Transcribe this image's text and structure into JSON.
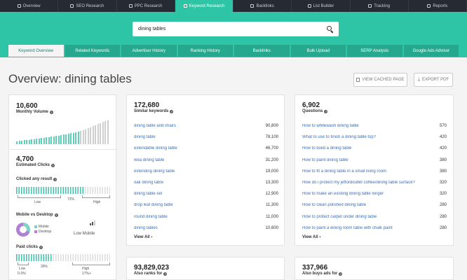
{
  "nav": {
    "items": [
      {
        "label": "Overview",
        "active": false
      },
      {
        "label": "SEO Research",
        "active": false
      },
      {
        "label": "PPC Research",
        "active": false
      },
      {
        "label": "Keyword Research",
        "active": true
      },
      {
        "label": "Backlinks",
        "active": false
      },
      {
        "label": "List Builder",
        "active": false
      },
      {
        "label": "Tracking",
        "active": false
      },
      {
        "label": "Reports",
        "active": false
      }
    ]
  },
  "search": {
    "value": "dining tables"
  },
  "subtabs": [
    {
      "label": "Keyword Overview",
      "active": true
    },
    {
      "label": "Related Keywords",
      "active": false
    },
    {
      "label": "Advertiser History",
      "active": false
    },
    {
      "label": "Ranking History",
      "active": false
    },
    {
      "label": "Backlinks",
      "active": false
    },
    {
      "label": "Bulk Upload",
      "active": false
    },
    {
      "label": "SERP Analysis",
      "active": false
    },
    {
      "label": "Google Ads Advisor",
      "active": false
    }
  ],
  "page": {
    "title": "Overview: dining tables",
    "view_cached_label": "VIEW CACHED PAGE",
    "export_pdf_label": "EXPORT PDF"
  },
  "stats": {
    "monthly_volume": {
      "value": "10,600",
      "label": "Monthly Volume"
    },
    "estimated_clicks": {
      "value": "4,700",
      "label": "Estimated Clicks"
    },
    "clicked_any_result": {
      "label": "Clicked any result",
      "percent_text": "72%",
      "percent": 72,
      "low": "Low",
      "high": "High"
    },
    "mobile_vs_desktop": {
      "label": "Mobile vs Desktop",
      "mobile": "Mobile",
      "desktop": "Desktop",
      "summary": "Low Mobile"
    },
    "paid_clicks": {
      "label": "Paid clicks",
      "percent_text": "39%",
      "percent": 39,
      "low": "Low",
      "low_range": "0-3%",
      "high": "High",
      "high_range": "17%+"
    }
  },
  "similar": {
    "count": "172,680",
    "label": "Similar keywords",
    "rows": [
      {
        "kw": "dining table and chairs",
        "vol": "90,800"
      },
      {
        "kw": "dining table",
        "vol": "78,100"
      },
      {
        "kw": "extendable dining table",
        "vol": "46,700"
      },
      {
        "kw": "ikea dining table",
        "vol": "31,200"
      },
      {
        "kw": "extending dining table",
        "vol": "19,000"
      },
      {
        "kw": "oak dining table",
        "vol": "13,300"
      },
      {
        "kw": "dining table set",
        "vol": "12,900"
      },
      {
        "kw": "drop leaf dining table",
        "vol": "11,300"
      },
      {
        "kw": "round dining table",
        "vol": "11,000"
      },
      {
        "kw": "dining tables",
        "vol": "10,600"
      }
    ],
    "view_all": "View All"
  },
  "questions": {
    "count": "6,902",
    "label": "Questions",
    "rows": [
      {
        "kw": "How to whitewash dining table",
        "vol": "570"
      },
      {
        "kw": "What to use to finish a dining table top?",
        "vol": "420"
      },
      {
        "kw": "How to build a dining table",
        "vol": "420"
      },
      {
        "kw": "How to paint dining table",
        "vol": "380"
      },
      {
        "kw": "How to fit a dining table in a small living room",
        "vol": "380"
      },
      {
        "kw": "How do i protect my jeffordoutlet coffee/dining table surface?",
        "vol": "320"
      },
      {
        "kw": "How to make an existing dining table longer",
        "vol": "320"
      },
      {
        "kw": "How to clean polished dining table",
        "vol": "280"
      },
      {
        "kw": "How to protect carpet under dining table",
        "vol": "280"
      },
      {
        "kw": "How to paint a dining room table with chalk paint",
        "vol": "280"
      }
    ],
    "view_all": "View All"
  },
  "also_ranks": {
    "count": "93,829,023",
    "label": "Also ranks for"
  },
  "also_buys": {
    "count": "337,966",
    "label": "Also buys ads for"
  },
  "colors": {
    "accent": "#2ec4a6",
    "nav_bg": "#262b33",
    "link": "#3b6fb6"
  },
  "volume_trend": [
    4,
    5,
    5,
    6,
    6,
    6,
    7,
    7,
    8,
    8,
    9,
    9,
    10,
    10,
    11,
    11,
    12,
    12,
    13,
    14,
    14,
    15,
    16,
    17,
    18,
    19,
    20,
    21,
    22,
    24,
    25,
    27,
    28,
    30,
    31,
    33,
    34,
    35
  ]
}
